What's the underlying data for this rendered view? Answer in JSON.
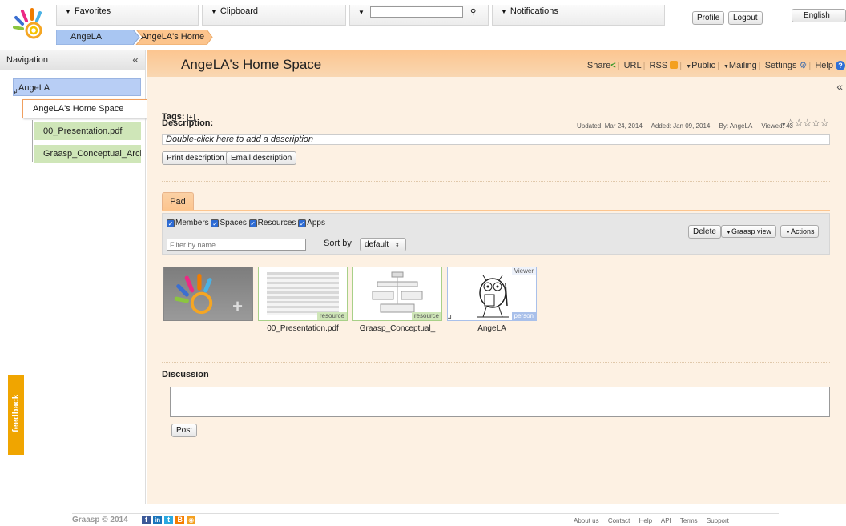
{
  "topbar": {
    "favorites": "Favorites",
    "clipboard": "Clipboard",
    "search_placeholder": "",
    "notifications": "Notifications",
    "profile": "Profile",
    "logout": "Logout",
    "language": "English"
  },
  "breadcrumb": [
    "AngeLA",
    "AngeLA's Home"
  ],
  "nav": {
    "title": "Navigation",
    "items": [
      "AngeLA",
      "AngeLA's Home Space",
      "00_Presentation.pdf",
      "Graasp_Conceptual_Arch"
    ]
  },
  "feedback": "feedback",
  "main": {
    "title": "AngeLA's Home Space",
    "links": [
      "Share",
      "URL",
      "RSS",
      "Public",
      "Mailing",
      "Settings",
      "Help"
    ],
    "tags_label": "Tags:",
    "description_label": "Description:",
    "meta": {
      "updated": "Updated: Mar 24, 2014",
      "added": "Added: Jan 09, 2014",
      "by": "By: AngeLA",
      "viewed": "Viewed: 43"
    },
    "description_placeholder": "Double-click here to add a description",
    "print_button": "Print description",
    "email_button": "Email description",
    "pad_tab": "Pad",
    "filters": [
      "Members",
      "Spaces",
      "Resources",
      "Apps"
    ],
    "filter_placeholder": "Filter by name",
    "sort_label": "Sort by",
    "sort_value": "default",
    "delete_button": "Delete",
    "graasp_view_button": "Graasp view",
    "actions_button": "Actions",
    "items": [
      {
        "caption": "",
        "tag": ""
      },
      {
        "caption": "00_Presentation.pdf",
        "tag": "resource"
      },
      {
        "caption": "Graasp_Conceptual_‫",
        "tag": "resource"
      },
      {
        "caption": "AngeLA",
        "tag": "person",
        "corner": "Viewer"
      }
    ],
    "discussion_label": "Discussion",
    "post_button": "Post"
  },
  "footer": {
    "copyright": "Graasp © 2014",
    "links": [
      "About us",
      "Contact",
      "Help",
      "API",
      "Terms",
      "Support"
    ]
  },
  "colors": {
    "accent": "#f5a05a",
    "nav_selected": "#b8cef5",
    "nav_resource": "#cfe6b8"
  }
}
